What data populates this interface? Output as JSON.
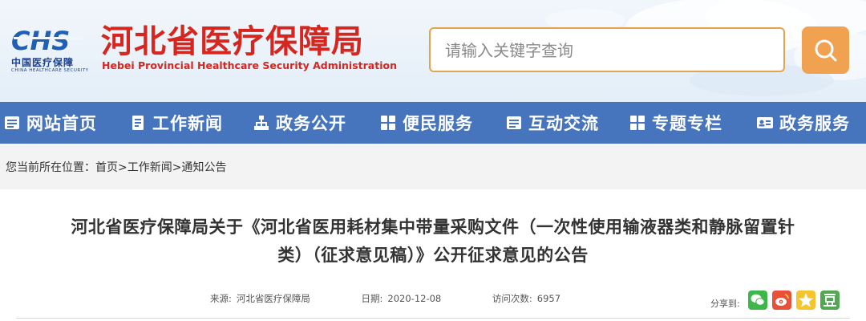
{
  "header": {
    "logo_mark": "CHS",
    "logo_cn": "中国医疗保障",
    "logo_en": "CHINA HEALTHCARE SECURITY",
    "title": "河北省医疗保障局",
    "subtitle": "Hebei Provincial Healthcare Security Administration"
  },
  "search": {
    "placeholder": "请输入关键字查询",
    "button_icon": "search-icon"
  },
  "nav": {
    "items": [
      {
        "label": "网站首页",
        "icon": "list-icon"
      },
      {
        "label": "工作新闻",
        "icon": "document-icon"
      },
      {
        "label": "政务公开",
        "icon": "sitemap-icon"
      },
      {
        "label": "便民服务",
        "icon": "grid-icon"
      },
      {
        "label": "互动交流",
        "icon": "list-icon"
      },
      {
        "label": "专题专栏",
        "icon": "grid-icon"
      },
      {
        "label": "政务服务",
        "icon": "id-card-icon"
      }
    ]
  },
  "breadcrumb": {
    "prefix": "您当前所在位置：",
    "path": "首页>工作新闻>通知公告"
  },
  "article": {
    "title_line1": "河北省医疗保障局关于《河北省医用耗材集中带量采购文件（一次性使用输液器类和静脉留置针",
    "title_line2": "类）（征求意见稿）》公开征求意见的公告",
    "source_label": "来源:",
    "source_value": "河北省医疗保障局",
    "date_label": "日期:",
    "date_value": "2020-12-08",
    "views_label": "访问次数:",
    "views_value": "6957"
  },
  "share": {
    "label": "分享到:",
    "targets": [
      "wechat-icon",
      "weibo-icon",
      "qzone-icon",
      "douban-icon"
    ]
  },
  "colors": {
    "nav_bg": "#4674bd",
    "brand_red": "#d5261f",
    "accent_orange": "#f0a250"
  }
}
